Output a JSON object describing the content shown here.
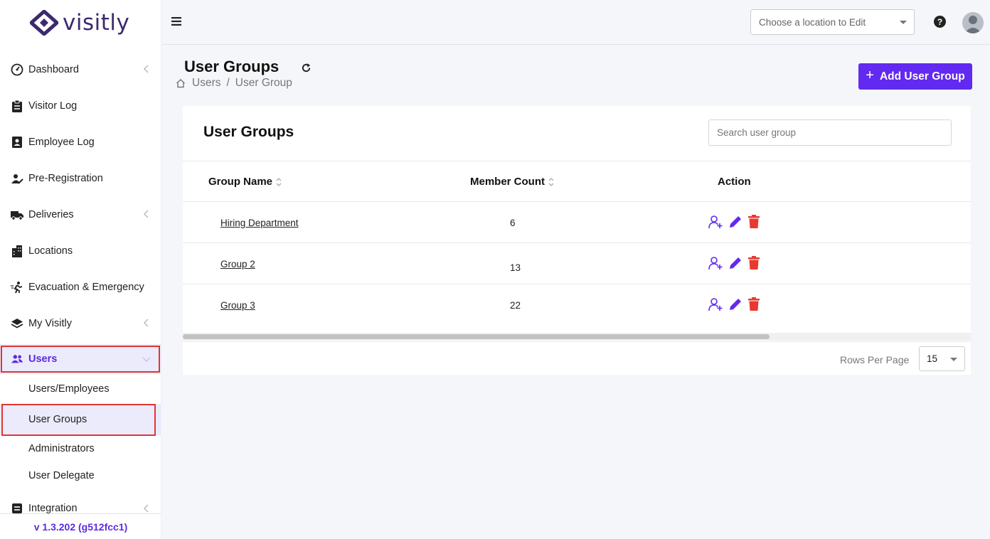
{
  "brand": {
    "name": "visitly",
    "color": "#3c2a6e",
    "accent": "#5b2be0"
  },
  "sidebar": {
    "items": [
      {
        "label": "Dashboard",
        "icon": "gauge-icon",
        "has_chevron": true
      },
      {
        "label": "Visitor Log",
        "icon": "clipboard-icon",
        "has_chevron": false
      },
      {
        "label": "Employee Log",
        "icon": "id-badge-icon",
        "has_chevron": false
      },
      {
        "label": "Pre-Registration",
        "icon": "user-edit-icon",
        "has_chevron": false
      },
      {
        "label": "Deliveries",
        "icon": "truck-icon",
        "has_chevron": true
      },
      {
        "label": "Locations",
        "icon": "building-icon",
        "has_chevron": false
      },
      {
        "label": "Evacuation & Emergency",
        "icon": "running-person-icon",
        "has_chevron": false
      },
      {
        "label": "My Visitly",
        "icon": "layers-icon",
        "has_chevron": true
      },
      {
        "label": "Users",
        "icon": "users-icon",
        "has_chevron": true,
        "active": true
      }
    ],
    "sub_items": [
      {
        "label": "Users/Employees"
      },
      {
        "label": "User Groups",
        "active": true
      },
      {
        "label": "Administrators"
      },
      {
        "label": "User Delegate"
      }
    ],
    "integration": {
      "label": "Integration",
      "icon": "integration-icon"
    },
    "version": "v 1.3.202 (g512fcc1)"
  },
  "topbar": {
    "location_placeholder": "Choose a location to Edit",
    "help_icon": "question-circle-icon",
    "avatar_icon": "user-avatar-icon"
  },
  "page": {
    "title": "User Groups",
    "breadcrumb": [
      "Users",
      "User Group"
    ],
    "breadcrumb_separator": "/",
    "add_button": "Add User Group",
    "add_button_color": "#6229f0"
  },
  "card": {
    "title": "User Groups",
    "search_placeholder": "Search user group",
    "columns": [
      "Group Name",
      "Member Count",
      "Action"
    ],
    "rows": [
      {
        "name": "Hiring Department",
        "count": "6"
      },
      {
        "name": "Group 2",
        "count": "13"
      },
      {
        "name": "Group 3",
        "count": "22"
      }
    ],
    "rows_per_page_label": "Rows Per Page",
    "rows_per_page": "15",
    "action_colors": {
      "add_member": "#6229f0",
      "edit": "#6229f0",
      "delete": "#e8392f"
    }
  }
}
